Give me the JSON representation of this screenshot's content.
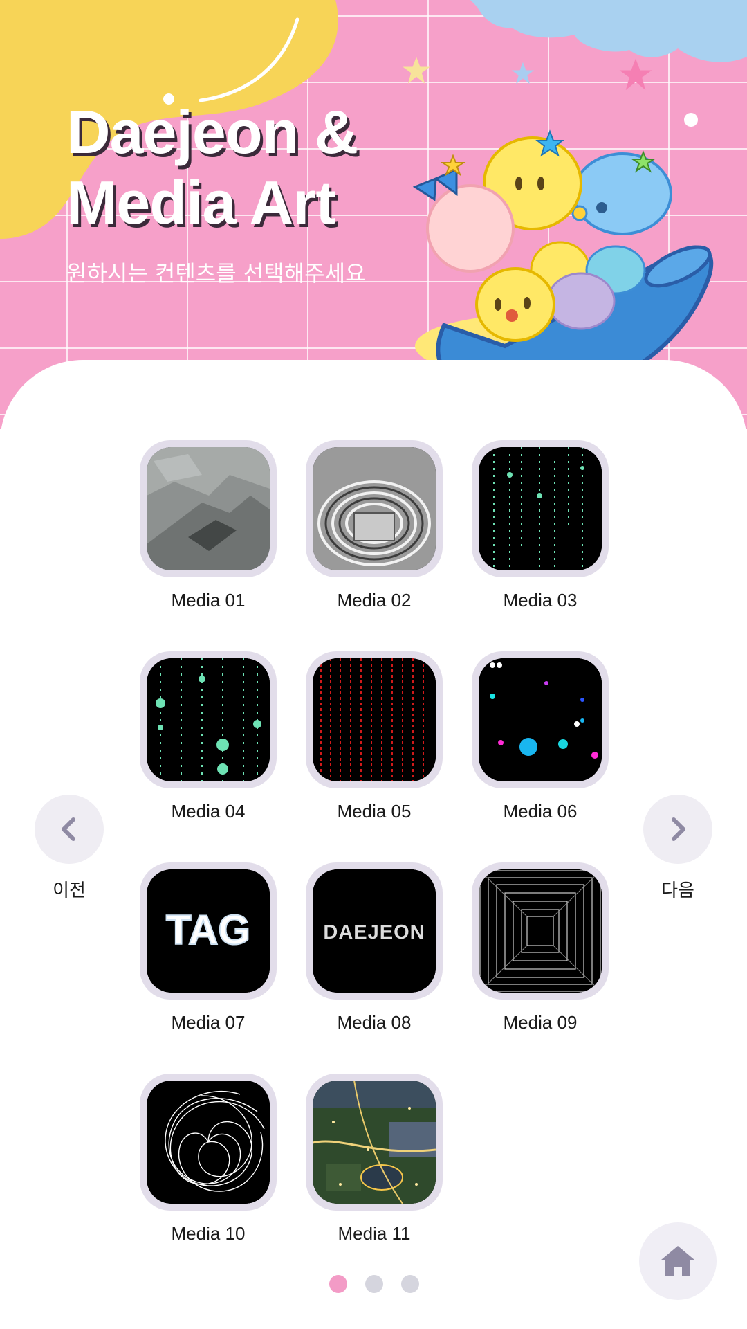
{
  "hero": {
    "title": "Daejeon &\nMedia Art",
    "subtitle": "원하시는 컨텐츠를 선택해주세요"
  },
  "media": [
    {
      "label": "Media 01",
      "thumb": "gray-terrain"
    },
    {
      "label": "Media 02",
      "thumb": "metal-tunnel"
    },
    {
      "label": "Media 03",
      "thumb": "green-rain"
    },
    {
      "label": "Media 04",
      "thumb": "green-rain-drops"
    },
    {
      "label": "Media 05",
      "thumb": "red-rain"
    },
    {
      "label": "Media 06",
      "thumb": "color-particles"
    },
    {
      "label": "Media 07",
      "thumb": "tag-text"
    },
    {
      "label": "Media 08",
      "thumb": "daejeon-text"
    },
    {
      "label": "Media 09",
      "thumb": "square-tunnel"
    },
    {
      "label": "Media 10",
      "thumb": "spiral-lines"
    },
    {
      "label": "Media 11",
      "thumb": "aerial-city"
    }
  ],
  "thumb_text": {
    "tag": "TAG",
    "daejeon": "DAEJEON"
  },
  "nav": {
    "prev_label": "이전",
    "next_label": "다음",
    "prev_icon": "chevron-left-icon",
    "next_icon": "chevron-right-icon",
    "home_icon": "home-icon"
  },
  "pagination": {
    "total": 3,
    "current": 1
  },
  "colors": {
    "hero_pink": "#f6a0c9",
    "accent_yellow": "#f7d457",
    "cloud_blue": "#a9d1f0",
    "tile_frame": "#e2ddea",
    "dot_active": "#f39bc6",
    "dot_inactive": "#d5d5de",
    "nav_icon": "#8f8aa3"
  }
}
